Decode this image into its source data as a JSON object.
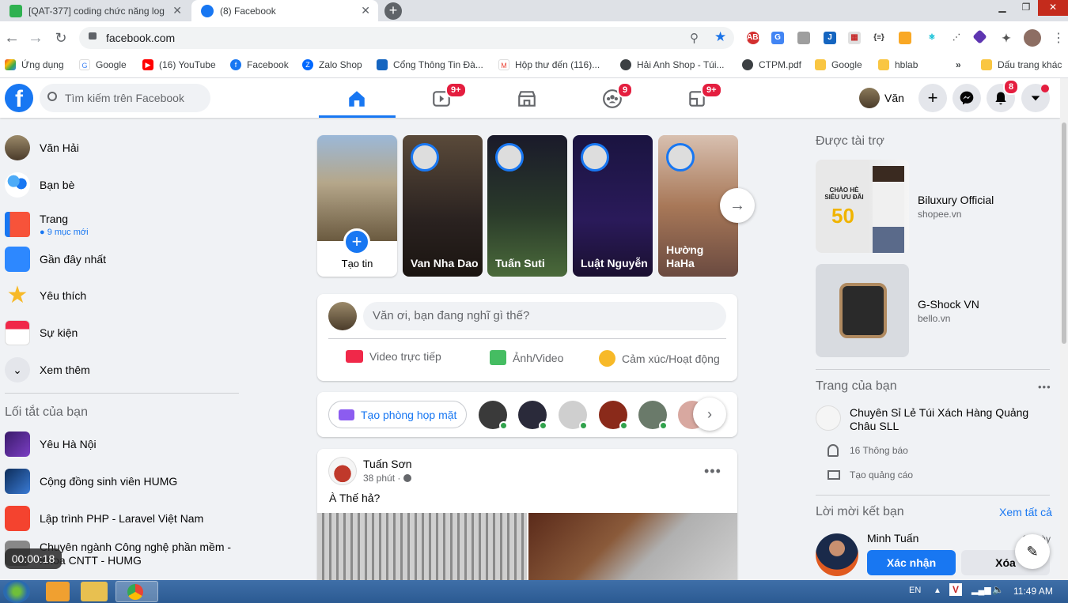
{
  "browser": {
    "tabs": [
      {
        "title": "[QAT-377] coding chức năng log",
        "favicon": "green-square-icon"
      },
      {
        "title": "(8) Facebook",
        "favicon": "facebook-icon"
      }
    ],
    "url": "facebook.com",
    "bookmarks": [
      "Ứng dụng",
      "Google",
      "(16) YouTube",
      "Facebook",
      "Zalo Shop",
      "Cổng Thông Tin Đà...",
      "Hộp thư đến (116)...",
      "Hải Anh Shop - Túi...",
      "CTPM.pdf",
      "Google",
      "hblab"
    ],
    "bookmarks_more": "»",
    "other_bookmarks": "Dấu trang khác"
  },
  "header": {
    "search_placeholder": "Tìm kiếm trên Facebook",
    "watch_badge": "9+",
    "groups_badge": "9",
    "gaming_badge": "9+",
    "profile_name": "Văn",
    "notif_badge": "8"
  },
  "left": {
    "items": [
      {
        "label": "Văn Hải"
      },
      {
        "label": "Bạn bè"
      },
      {
        "label": "Trang",
        "sub": "9 mục mới"
      },
      {
        "label": "Gần đây nhất"
      },
      {
        "label": "Yêu thích"
      },
      {
        "label": "Sự kiện"
      },
      {
        "label": "Xem thêm"
      }
    ],
    "shortcuts_title": "Lối tắt của bạn",
    "shortcuts": [
      "Yêu Hà Nội",
      "Cộng đồng sinh viên HUMG",
      "Lập trình PHP - Laravel Việt Nam",
      "Chuyên ngành Công nghệ phần mềm - Khoa CNTT - HUMG"
    ]
  },
  "recording_timer": "00:00:18",
  "stories": {
    "create_label": "Tạo tin",
    "items": [
      "Van Nha Dao",
      "Tuấn Suti",
      "Luật Nguyễn",
      "Hường HaHa"
    ]
  },
  "composer": {
    "placeholder": "Văn ơi, bạn đang nghĩ gì thế?",
    "live": "Video trực tiếp",
    "photo": "Ảnh/Video",
    "feeling": "Cảm xúc/Hoạt động"
  },
  "rooms": {
    "create_label": "Tạo phòng họp mặt"
  },
  "post": {
    "author": "Tuấn Sơn",
    "time": "38 phút ·",
    "text": "À Thế hả?"
  },
  "right": {
    "sponsored_title": "Được tài trợ",
    "ads": [
      {
        "name": "Biluxury Official",
        "domain": "shopee.vn",
        "promo_text": "CHÀO HÈ SIÊU ƯU ĐÃI",
        "promo_number": "50"
      },
      {
        "name": "G-Shock VN",
        "domain": "bello.vn"
      }
    ],
    "your_pages_title": "Trang của bạn",
    "page_name": "Chuyên Sỉ Lẻ Túi Xách Hàng Quảng Châu SLL",
    "page_notifications": "16 Thông báo",
    "page_create_ad": "Tạo quảng cáo",
    "friend_requests_title": "Lời mời kết bạn",
    "see_all": "Xem tất cả",
    "request_name": "Minh Tuấn",
    "request_time": "1 ngày",
    "confirm": "Xác nhận",
    "delete": "Xóa"
  },
  "taskbar": {
    "lang": "EN",
    "time": "11:49 AM"
  },
  "colors": {
    "fb_blue": "#1877f2",
    "badge_red": "#e41e3f"
  }
}
